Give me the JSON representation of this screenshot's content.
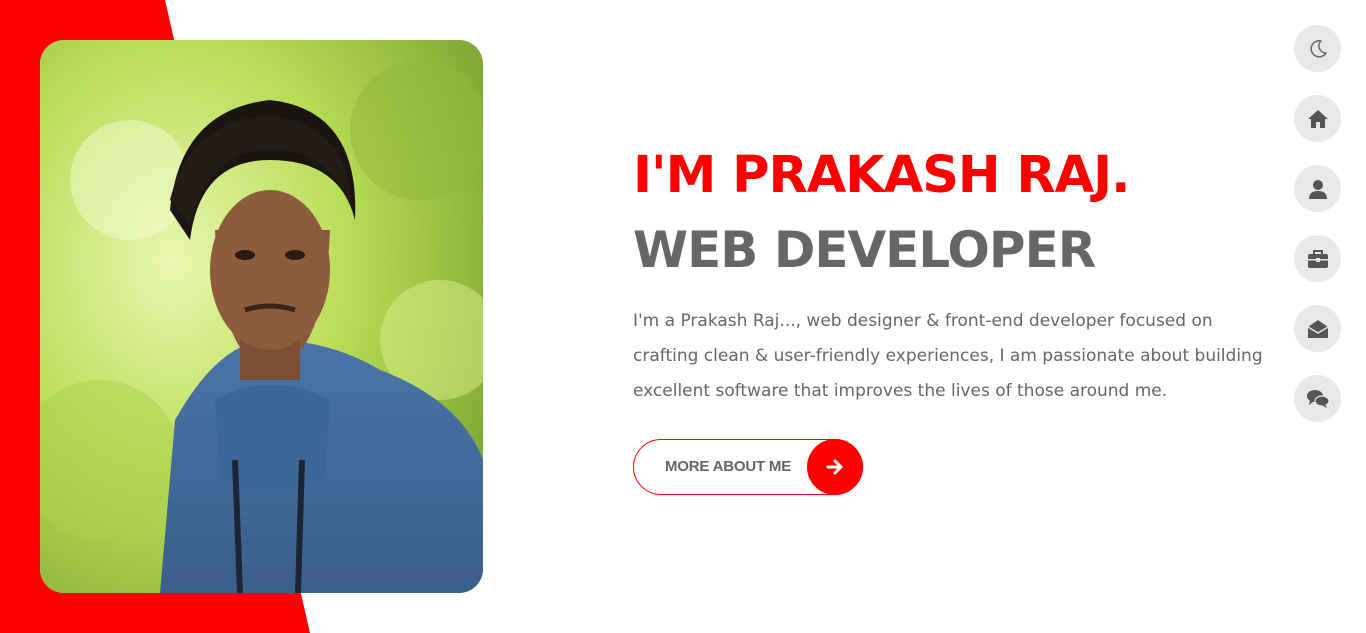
{
  "hero": {
    "title": "I'M PRAKASH RAJ.",
    "subtitle": "WEB DEVELOPER",
    "bio": "I'm a Prakash Raj..., web designer & front-end developer focused on crafting clean & user-friendly experiences, I am passionate about building excellent software that improves the lives of those around me."
  },
  "cta": {
    "label": "MORE ABOUT ME",
    "icon": "arrow-right-icon"
  },
  "side_nav": {
    "items": [
      {
        "icon": "moon-icon"
      },
      {
        "icon": "home-icon"
      },
      {
        "icon": "user-icon"
      },
      {
        "icon": "briefcase-icon"
      },
      {
        "icon": "envelope-open-icon"
      },
      {
        "icon": "comments-icon"
      }
    ]
  },
  "colors": {
    "accent": "#ff0000",
    "text": "#666666",
    "nav_bg": "#e8e8e8"
  }
}
